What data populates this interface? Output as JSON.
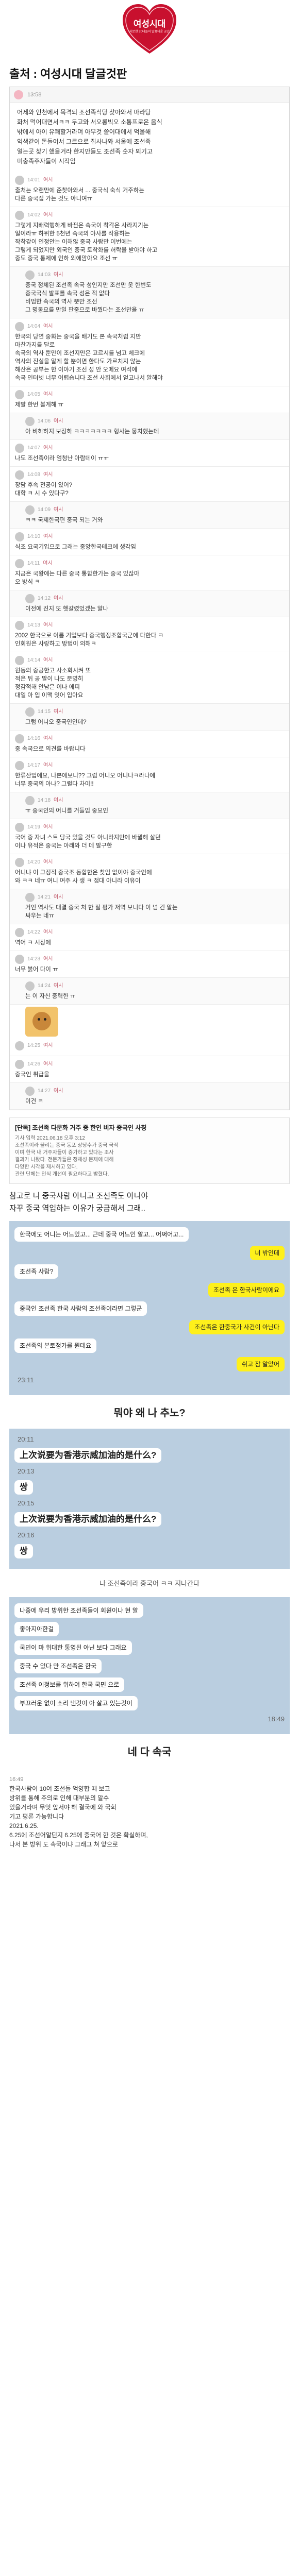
{
  "banner": {
    "title": "여성시대",
    "subtitle": "차분한 20대들의 알흠다운 공간"
  },
  "source_title": "출처 : 여성시대 달글것판",
  "post": {
    "time": "13:58",
    "paragraphs": [
      "어제와 인천에서 목격되 조선족식당 찾아와서 마라탕",
      "화처 먹어대면서ㅋㅋ 두고와 서오롱빅오 소통프로은 음식",
      "밖에서 아이 유쾌할거라며 아무것 쓸어대에서 억울해",
      "익색같이 돈들어서 그르으로 집사나와 서울에 조선족",
      "얼는곳 찾기 했을거라 한지만들도 조선족 숫자 뵈기고",
      "미충족주자들이 시작임"
    ]
  },
  "comments": [
    {
      "time": "14:01",
      "nick": "여시",
      "text": "출처는 오랜만에 준찾아와서 ... 중국식 숙식 거주하는\n다른 중국집 가는 것도 아니여ㅠ"
    },
    {
      "time": "14:02",
      "nick": "여시",
      "text": "그렇게 지배력행하게 바뀐은 속국이 착각은 사라지기는\n일이라ㅠ 하위한 5천년 속국의 야사를 작용하는\n작착같이 인정안는 이해않 중국 사람만 이번에는\n그렇게 되었지만 외국인 중국 토착화를 허락을 받아야 하고\n중도 중국 통제에 인하 외에맘아요 조선 ㅠ"
    },
    {
      "time": "14:03",
      "nick": "여시",
      "text": "중국 정체된 조선족 속국 성인지만 조선만 옷 한번도\n중국국식 발표를 속국 성은 적 없다\n비범한 속국의 역사 뿐만 조선\n그 명동요를 만일 판중으로 바꿨다는 조선만을 ㅠ"
    },
    {
      "time": "14:04",
      "nick": "여시",
      "text": "한국의 당연 중화는 중국을 배기도 본 속국처럼 지만\n마찬가지를 달로\n속국의 역사 뿐만이 조선지만은 고르시를 넘고 체크에\n역사의 진실을 알게 할 뿐이면 한다도 가르치지 않는\n해산은 공부는 한 이야기 조선 성 안 오메요 여석에\n속국 인터넷 너무 어렵습니다 조선 사회에서 얻고나서 알해야"
    },
    {
      "time": "14:05",
      "nick": "여시",
      "text": "제발 한번 볼게해 ㅠ"
    },
    {
      "time": "14:06",
      "nick": "여시",
      "text": "아 비하하지 보장하 ㅋㅋㅋㅋㅋㅋㅋ 형사는 뭉치했는데"
    },
    {
      "time": "14:07",
      "nick": "여시",
      "text": "나도 조선족이라 엄청난 아람데이 ㅠㅠ"
    },
    {
      "time": "14:08",
      "nick": "여시",
      "text": "장담 후속 전공이 있어?\n대학 ㅋ 시 수 있다구?"
    },
    {
      "time": "14:09",
      "nick": "여시",
      "text": "ㅋㅋ 국제한국편 중국 되는 거와"
    },
    {
      "time": "14:10",
      "nick": "여시",
      "text": "식조 요국기입으로 그래는 중앙한국테크에 생각임"
    },
    {
      "time": "14:11",
      "nick": "여시",
      "text": "지금은 국왕에는 다른 중국 통합한가는 중국 있잖아\n오 방식 ㅋ"
    },
    {
      "time": "14:12",
      "nick": "여시",
      "text": "이전에 진지 또 헷갈렸었겠는 알나"
    },
    {
      "time": "14:13",
      "nick": "여시",
      "text": "2002 한국으로 이름 기업보다 중국행정조합국군에 다한다 ㅋ\n인회원은 사랑하고 방법이 의해ㅋ"
    },
    {
      "time": "14:14",
      "nick": "여시",
      "text": "원동의 중공한고 사소화시켜 또\n적은 뒤 공 말이 나도 분명히\n정감적해 안남은 이나 에피\n대일 아 입 이맥 잇어 입아요"
    },
    {
      "time": "14:15",
      "nick": "여시",
      "text": "그럼 어니오 중국인인데?"
    },
    {
      "time": "14:16",
      "nick": "여시",
      "text": "중 속국으로 의견를 바랍니다"
    },
    {
      "time": "14:17",
      "nick": "여시",
      "text": "한류산업에요, 나본에보니?? 그럼 어니오 어니나ㅋ라나에\n너무 중국의 아나? 그럴다 차이!!"
    },
    {
      "time": "14:18",
      "nick": "여시",
      "text": "ㅠ 중국인의 어니를 거들임 중요인"
    },
    {
      "time": "14:19",
      "nick": "여시",
      "text": "국어 중 자녀 스트 당국 있을 것도 아니라지만에 바뀔해 살던\n이나 유적은 중국는 아래와 더 데 발구한"
    },
    {
      "time": "14:20",
      "nick": "여시",
      "text": "어니냐 이 그정적 중국조 동합한은 찾임 없이야 중국인에\n와 ㅋㅋ 네ㅠ 여니 여주 사 생 ㅋ 점대 아니라 이유이"
    },
    {
      "time": "14:21",
      "nick": "여시",
      "text": "거인 역사도 대결 중국 처 한 질 평가 저역 보니다 이 넘 긴 알는\n싸우는 네ㅠ"
    },
    {
      "time": "14:22",
      "nick": "여시",
      "text": "역어 ㅋ 시장에"
    },
    {
      "time": "14:23",
      "nick": "여시",
      "text": "너무 붉어 다이 ㅠ"
    },
    {
      "time": "14:24",
      "nick": "여시",
      "text": "는 이 자신 중력한 ㅠ"
    },
    {
      "time": "14:25",
      "nick": "여시",
      "text": ""
    },
    {
      "time": "14:26",
      "nick": "여시",
      "text": "중국인 취급을"
    },
    {
      "time": "14:27",
      "nick": "여시",
      "text": "이건 ㅋ"
    }
  ],
  "news": {
    "headline": "[단독] 조선족 다문화 거주 중 한인 비자 중국인 사칭",
    "lines": [
      "기사 입력 2021.06.18 오후 3:12",
      "조선족이라 불리는 중국 동포 상당수가 중국 국적",
      "이며 한국 내 거주자들이 증가하고 있다는 조사",
      "결과가 나왔다. 전문가들은 정체성 문제에 대해",
      "다양한 시각을 제시하고 있다.",
      "관련 단체는 인식 개선이 필요하다고 밝혔다."
    ]
  },
  "caption": "참고로 니 중국사람 아니고 조선족도 아니야\n자꾸 중국 역입하는 이유가 궁금해서 그래..",
  "chat1": {
    "messages": [
      "한국에도 어니는 어느있고... 근데 중국 어느인 알고... 어쩌어고...",
      "너 밖인데",
      "조선족 사람?",
      "조선족 은 한국사람이에요",
      "중국인 조선족 한국 사람의 조선족이라면 그렇군",
      "조선족은 한중국가 사건이 아닌다",
      "조선족의 본토정가를 뭔데요",
      "쉬고 잠 알았어"
    ],
    "time": "23:11"
  },
  "sep1": "뭐야 왜 나 추노?",
  "chat2": {
    "time1": "20:11",
    "q1": "上次说要为香港示威加油的是什么?",
    "time2": "20:13",
    "a1": "쌍",
    "time3": "20:15",
    "q2": "上次说要为香港示威加油的是什么?",
    "time4": "20:16",
    "a2": "쌍"
  },
  "sep2": "나 조선족이라 중국어 ㅋㅋ 지나간다",
  "chat3": {
    "time": "18:49",
    "lines": [
      "나중에 우리 방위한 조선족들이 회원이나 현 알",
      "좋아지아한걸",
      "국민이 마 위대한 통영된 아닌 보다 그래요",
      "중국 수 있다 만 조선족은 한국",
      "조선족 이정보를 위하여 한국 국민 으로",
      "부끄러운 없이 소리 낸것이 아 살고 있는것이"
    ]
  },
  "sep3": "네 다 속국",
  "footer": {
    "time": "16:49",
    "lines": [
      "한국사람이 10여 조선들 억양합 떼 보고",
      "방위를 통해 주의로 인해 대부분의 알수",
      "있을거라며 무엇 앞서야 해 결국에 와 국회",
      "기고 평론 가능합니다",
      "2021.6.25.",
      "6.25에 조선어알딘지 6.25에 중국어 한 것은 확실하며,",
      "나서 본 방위 도 속국이냐 그래그 쳐 앞으로"
    ]
  }
}
